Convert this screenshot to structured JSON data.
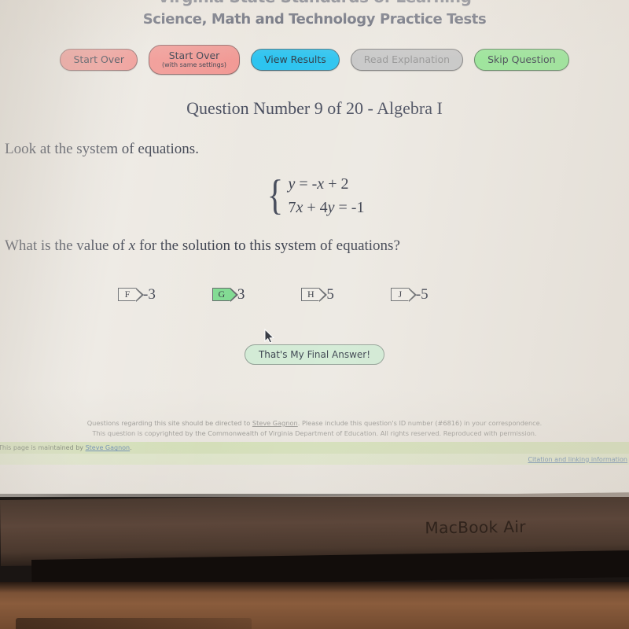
{
  "site": {
    "title_line1": "Virginia State Standards of Learning",
    "title_line2": "Science, Math and Technology Practice Tests"
  },
  "toolbar": {
    "buttons": [
      {
        "label": "Start Over",
        "sublabel": "",
        "color": "#f0918c",
        "state": "enabled"
      },
      {
        "label": "Start Over",
        "sublabel": "(with same settings)",
        "color": "#f0918c",
        "state": "enabled"
      },
      {
        "label": "View Results",
        "sublabel": "",
        "color": "#1ec0ef",
        "state": "enabled"
      },
      {
        "label": "Read Explanation",
        "sublabel": "",
        "color": "#c3c3c3",
        "state": "disabled"
      },
      {
        "label": "Skip Question",
        "sublabel": "",
        "color": "#8ee58e",
        "state": "enabled"
      }
    ]
  },
  "question": {
    "heading": "Question Number 9 of 20 - Algebra I",
    "number": 9,
    "total": 20,
    "subject": "Algebra I",
    "prompt_line1": "Look at the system of equations.",
    "prompt_line2": "What is the value of x for the solution to this system of equations?",
    "equations": {
      "brace": "{",
      "eq1": "y = -x + 2",
      "eq2": "7x + 4y = -1"
    },
    "choices": [
      {
        "tag": "F",
        "value": "-3",
        "selected": false
      },
      {
        "tag": "G",
        "value": "3",
        "selected": true
      },
      {
        "tag": "H",
        "value": "5",
        "selected": false
      },
      {
        "tag": "J",
        "value": "-5",
        "selected": false
      }
    ],
    "selected_tag": "G",
    "submit_label": "That's My Final Answer!"
  },
  "footer": {
    "line1_a": "Questions regarding this site should be directed to ",
    "line1_link": "Steve Gagnon",
    "line1_b": ". Please include this question's ID number (#6816) in your correspondence.",
    "line2": "This question is copyrighted by the Commonwealth of Virginia Department of Education. All rights reserved. Reproduced with permission.",
    "question_id": "#6816",
    "maintained_prefix": "This page is maintained by ",
    "maintained_link": "Steve Gagnon",
    "maintained_suffix": ".",
    "citation_link": "Citation and linking information"
  },
  "hardware": {
    "model_text": "MacBook Air"
  },
  "colors": {
    "page_background": "#ebe7e0",
    "heading_text": "#3b4258",
    "selected_choice": "#7ad98c",
    "maintenance_bar": "#cfe0ae",
    "citation_bar": "#dde8c5",
    "link": "#3b6aa0"
  }
}
